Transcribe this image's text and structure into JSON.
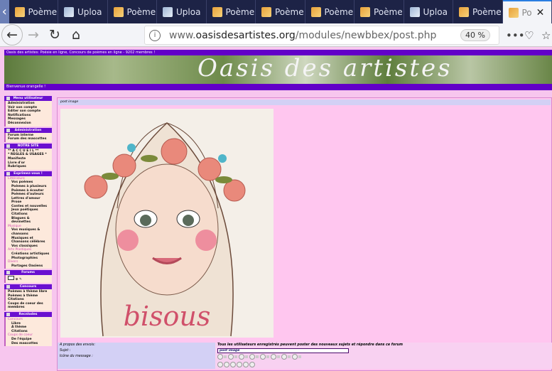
{
  "browser": {
    "tabs": [
      {
        "label": "Poème",
        "icon": "poeme"
      },
      {
        "label": "Uploa",
        "icon": "upload"
      },
      {
        "label": "Poème",
        "icon": "poeme"
      },
      {
        "label": "Uploa",
        "icon": "upload"
      },
      {
        "label": "Poème",
        "icon": "poeme"
      },
      {
        "label": "Poème",
        "icon": "poeme"
      },
      {
        "label": "Poème",
        "icon": "poeme"
      },
      {
        "label": "Poème",
        "icon": "poeme"
      },
      {
        "label": "Uploa",
        "icon": "upload"
      },
      {
        "label": "Poème",
        "icon": "poeme"
      },
      {
        "label": "Po",
        "icon": "poeme",
        "active": true
      }
    ],
    "url_prefix": "www.",
    "url_domain": "oasisdesartistes.org",
    "url_path": "/modules/newbbex/post.php",
    "zoom": "40 %"
  },
  "site": {
    "top_banner": "Oasis des artistes: Poésie en ligne, Concours de poèmes en ligne - 9202 membres !",
    "logo": "Oasis des artistes",
    "welcome": "Bienvenue orangelle !"
  },
  "sidebar": [
    {
      "title": "Menu utilisateur",
      "items": [
        "Administration",
        "Voir son compte",
        "Editer son compte",
        "Notifications",
        "Messages",
        "Déconnexion"
      ]
    },
    {
      "title": "Administration",
      "items": [
        "Forum interne",
        "Forum des mascottes"
      ]
    },
    {
      "title": "NOTRE SITE",
      "items": [
        "** A C C U E I L **",
        "* REGLES & USAGES *",
        "Manifeste",
        "Livre d'or",
        "Rubriques"
      ]
    },
    {
      "title": "Exprimez-vous !",
      "items": [
        {
          "cat": "Littérature"
        },
        "Vos poèmes",
        "Poèmes à plusieurs",
        "Poèmes à écouter",
        "Poèmes d'auteurs",
        "Lettres d'amour",
        "Prose",
        "Contes et nouvelles",
        "Jeux poétiques",
        "Citations",
        "Blagues & devinettes",
        {
          "cat": "Musique"
        },
        "Vos musiques & chansons",
        "Musiques et Chansons célèbres",
        "Vos classiques",
        {
          "cat": "Arts Plastiques"
        },
        "Créations artistiques",
        "Photographies",
        {
          "cat": "Divers"
        },
        "Partages Oasiens"
      ]
    },
    {
      "title": "Forums",
      "items": []
    },
    {
      "title": "Concours",
      "items": [
        "Poèmes à thème libre",
        "Poèmes à thème",
        "Citations",
        "Coups de coeur des membres"
      ]
    },
    {
      "title": "Recnlodes",
      "items": [
        {
          "cat": "Concours"
        },
        "Libre",
        "A thème",
        "Citations",
        {
          "cat": "Coups de coeur"
        },
        "De l'équipe",
        "Des mascottes"
      ]
    }
  ],
  "main": {
    "post_header": "post image",
    "image_caption": "bisous",
    "form": {
      "about_label": "A propos des envois:",
      "about_value": "Tous les utilisateurs enregistrés peuvent poster des nouveaux sujets et répondre dans ce forum",
      "subject_label": "Sujet :",
      "subject_value": "post image",
      "icon_label": "Icône du message :"
    }
  }
}
